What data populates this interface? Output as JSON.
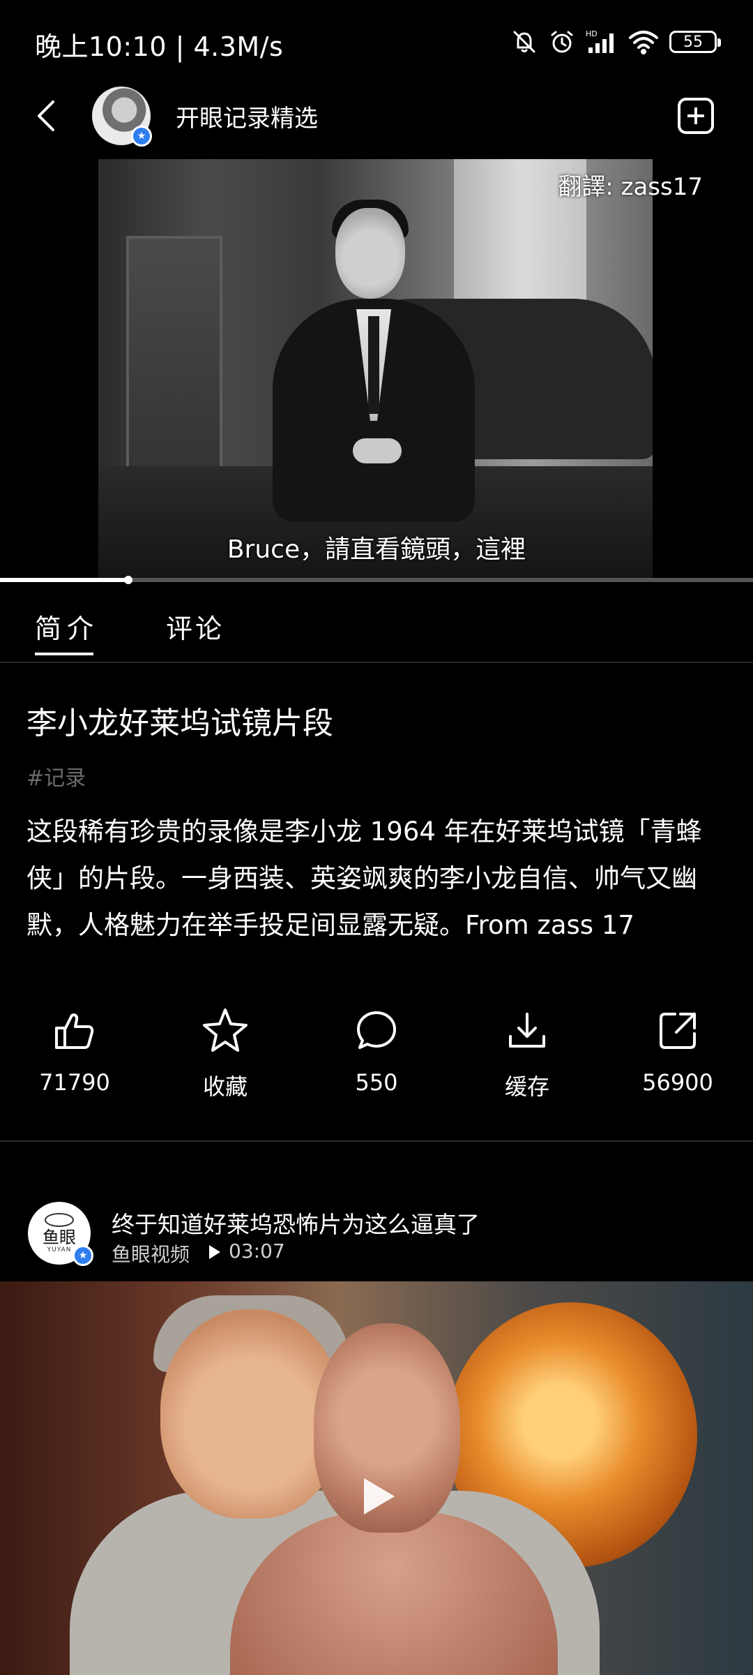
{
  "status_bar": {
    "left_text": "晚上10:10 | 4.3M/s",
    "battery": "55",
    "icons": [
      "bell-off-icon",
      "alarm-icon",
      "signal-hd-icon",
      "wifi-icon",
      "battery-icon"
    ]
  },
  "header": {
    "channel_name": "开眼记录精选",
    "icons": [
      "back-arrow-icon",
      "add-box-icon"
    ]
  },
  "video": {
    "translator_caption": "翻譯: zass17",
    "subtitle": "Bruce，請直看鏡頭，這裡",
    "progress": 0.17
  },
  "tabs": [
    {
      "label": "简介",
      "active": true
    },
    {
      "label": "评论",
      "active": false
    }
  ],
  "detail": {
    "title": "李小龙好莱坞试镜片段",
    "tag": "#记录",
    "description": "这段稀有珍贵的录像是李小龙 1964 年在好莱坞试镜「青蜂侠」的片段。一身西装、英姿飒爽的李小龙自信、帅气又幽默，人格魅力在举手投足间显露无疑。From zass 17"
  },
  "actions": [
    {
      "label": "71790",
      "icon": "thumbs-up-icon"
    },
    {
      "label": "收藏",
      "icon": "star-icon"
    },
    {
      "label": "550",
      "icon": "comment-icon"
    },
    {
      "label": "缓存",
      "icon": "download-icon"
    },
    {
      "label": "56900",
      "icon": "share-icon"
    }
  ],
  "recommended": {
    "avatar_text": "鱼眼",
    "avatar_subtext": "YUYAN",
    "title": "终于知道好莱坞恐怖片为这么逼真了",
    "source": "鱼眼视频",
    "duration": "03:07",
    "icons": [
      "play-icon"
    ]
  },
  "colors": {
    "background": "#000000",
    "text": "#ffffff",
    "muted": "#6b6b6b",
    "verified_badge": "#2f7ef0"
  }
}
